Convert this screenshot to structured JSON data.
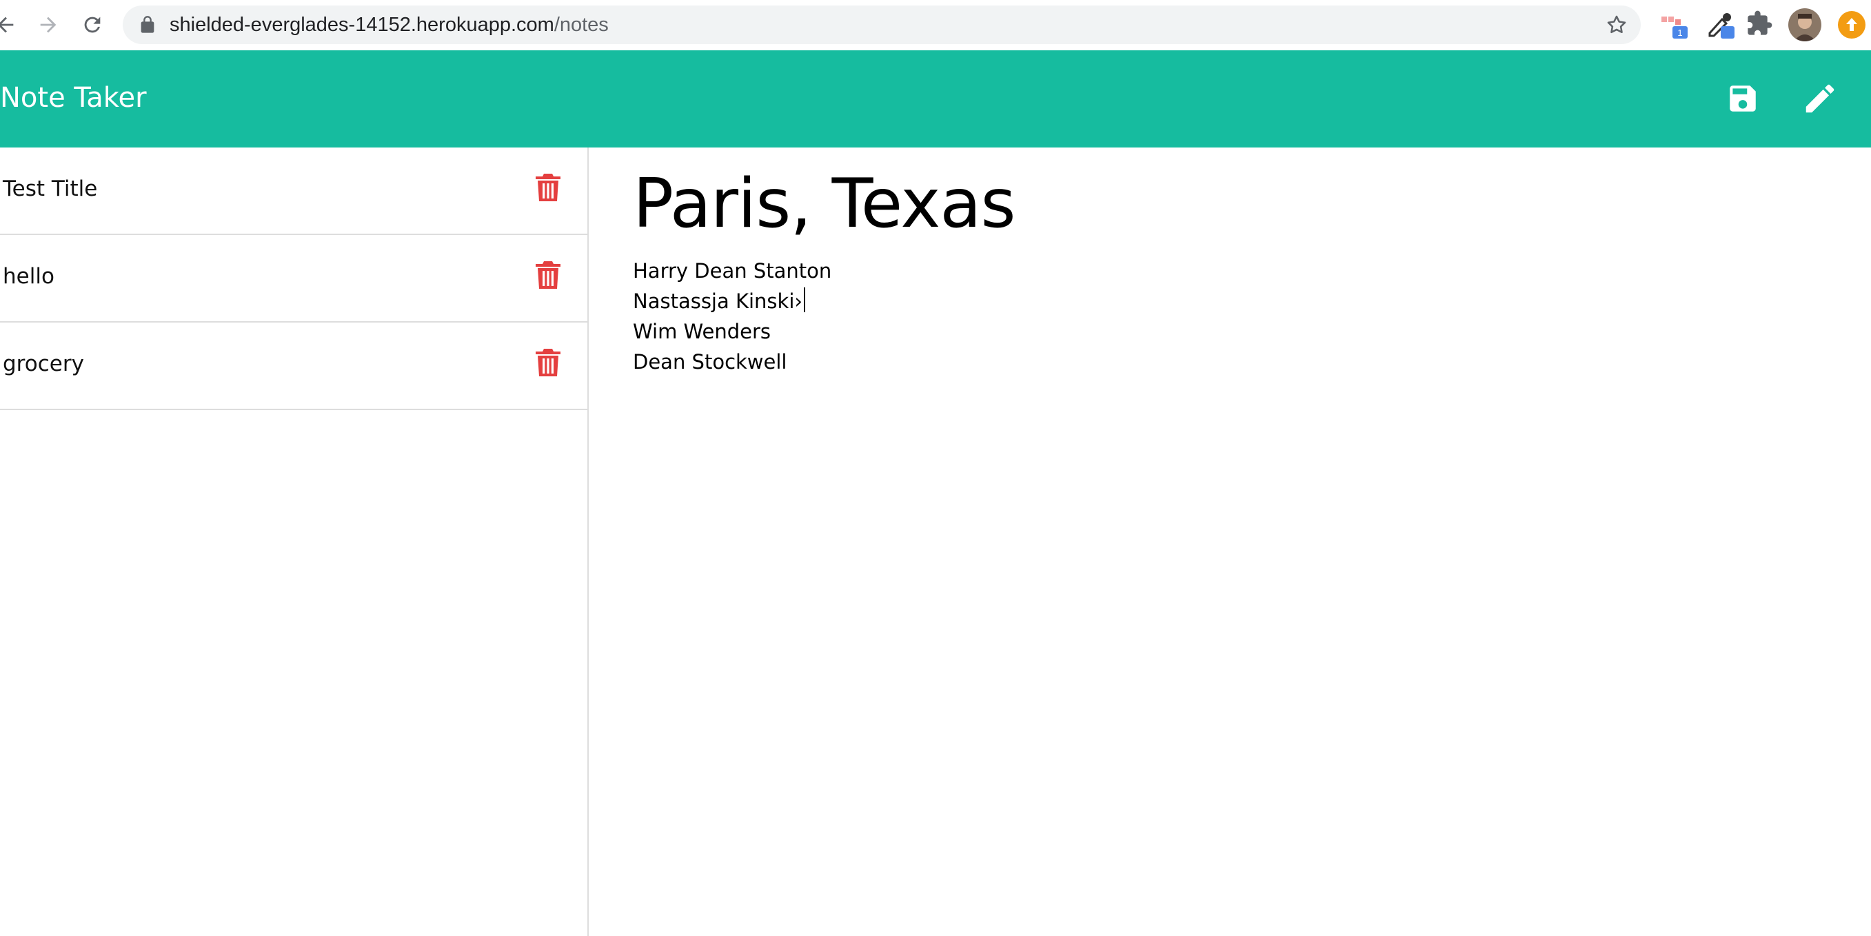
{
  "browser": {
    "url_host": "shielded-everglades-14152.herokuapp.com",
    "url_path": "/notes",
    "extension_badge": "1"
  },
  "header": {
    "brand": "Note Taker",
    "accent_color": "#16bc9f"
  },
  "sidebar": {
    "notes": [
      {
        "title": "Test Title"
      },
      {
        "title": "hello"
      },
      {
        "title": "grocery"
      }
    ],
    "delete_color": "#e43f3f"
  },
  "editor": {
    "title": "Paris, Texas",
    "body_lines": [
      "Harry Dean Stanton",
      "Nastassja Kinski›",
      "Wim Wenders",
      "Dean Stockwell"
    ]
  }
}
